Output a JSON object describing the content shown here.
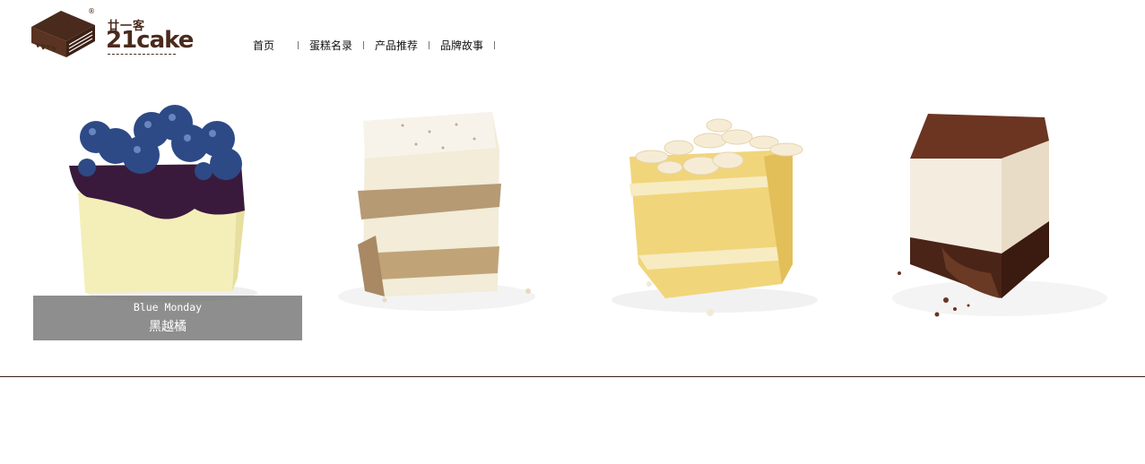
{
  "brand": {
    "name_cn": "廿一客",
    "name_en": "21cake",
    "reg_mark": "®",
    "color": "#4a2a1c"
  },
  "nav": {
    "items": [
      {
        "label": "首页"
      },
      {
        "label": "蛋糕名录"
      },
      {
        "label": "产品推荐"
      },
      {
        "label": "品牌故事"
      }
    ]
  },
  "gallery": {
    "items": [
      {
        "name": "blueberry-cake",
        "caption_en": "Blue Monday",
        "caption_cn": "黑越橘",
        "caption_visible": true
      },
      {
        "name": "tiramisu-cake"
      },
      {
        "name": "almond-sponge-cake"
      },
      {
        "name": "chocolate-mousse-cake"
      }
    ]
  },
  "colors": {
    "divider": "#3b2113",
    "caption_bg": "#6e6e6e"
  }
}
